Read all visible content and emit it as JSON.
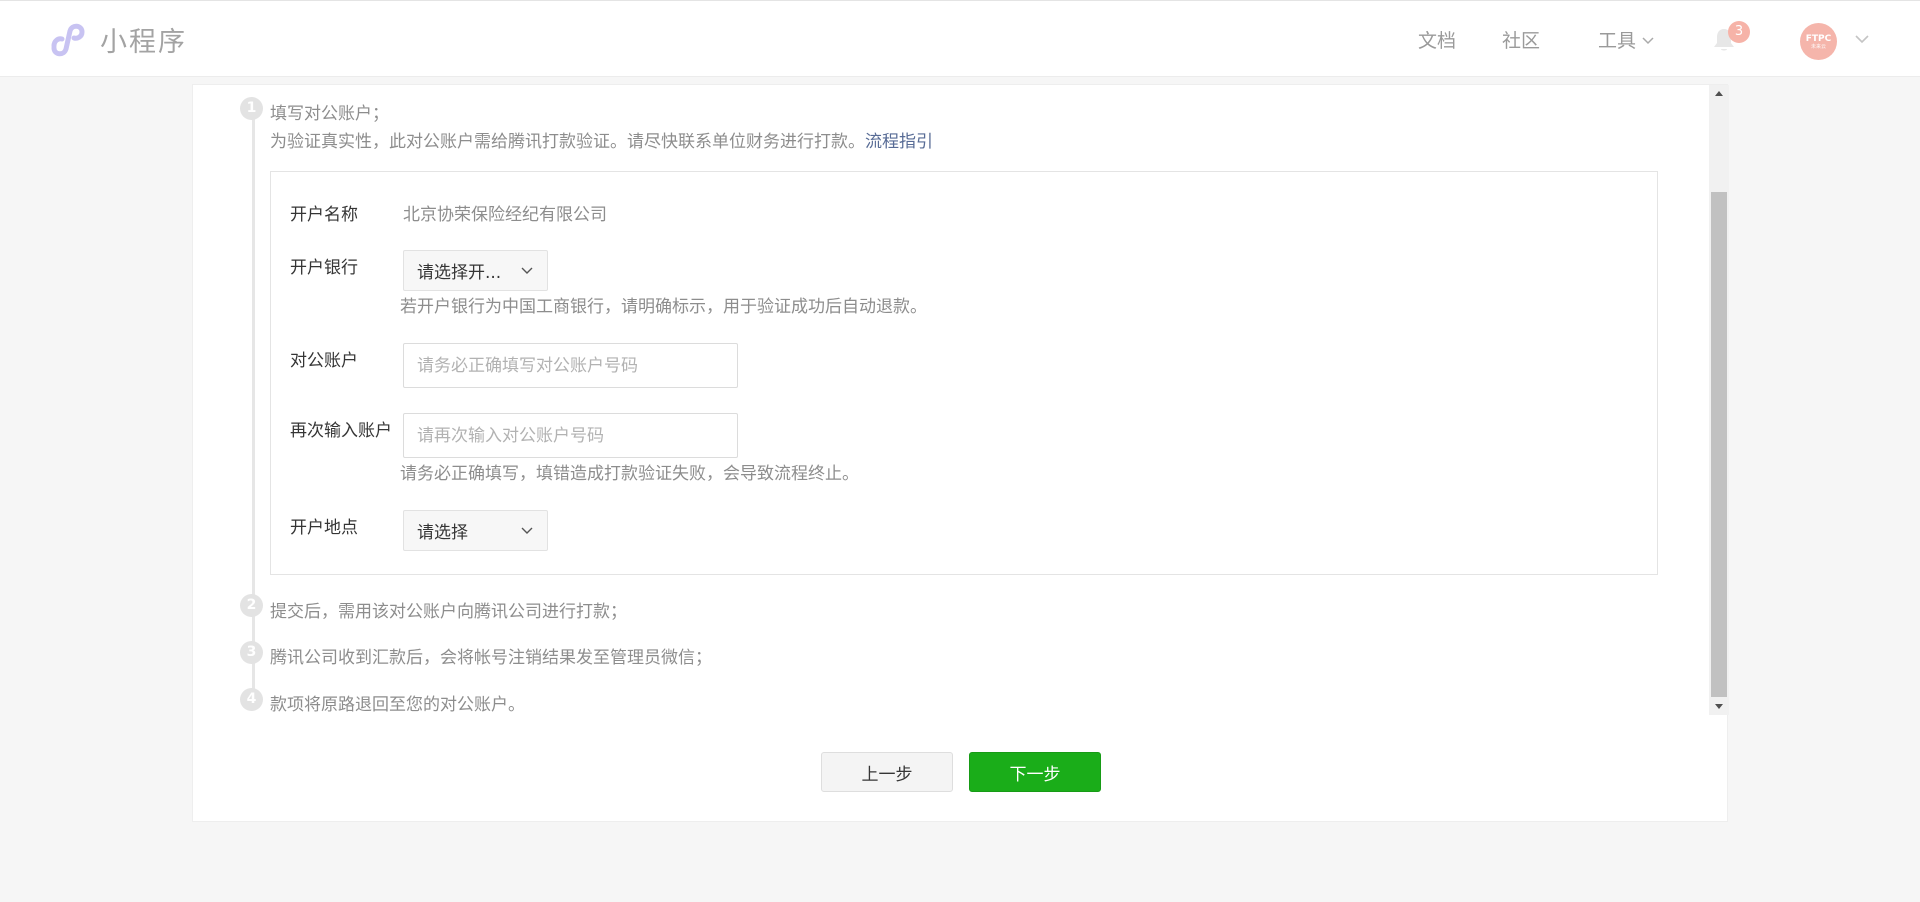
{
  "header": {
    "app_name": "小程序",
    "nav": {
      "docs": "文档",
      "community": "社区",
      "tools": "工具"
    },
    "notification_count": "3",
    "avatar": {
      "main": "FTPC",
      "sub": "未来云"
    }
  },
  "steps": [
    {
      "number": "1",
      "title": "填写对公账户；",
      "description": "为验证真实性，此对公账户需给腾讯打款验证。请尽快联系单位财务进行打款。",
      "link": "流程指引"
    },
    {
      "number": "2",
      "title": "提交后，需用该对公账户向腾讯公司进行打款；"
    },
    {
      "number": "3",
      "title": "腾讯公司收到汇款后，会将帐号注销结果发至管理员微信；"
    },
    {
      "number": "4",
      "title": "款项将原路退回至您的对公账户。"
    }
  ],
  "form": {
    "account_name": {
      "label": "开户名称",
      "value": "北京协荣保险经纪有限公司"
    },
    "bank": {
      "label": "开户银行",
      "selected": "请选择开...",
      "tip": "若开户银行为中国工商银行，请明确标示，用于验证成功后自动退款。"
    },
    "account": {
      "label": "对公账户",
      "value": "",
      "placeholder": "请务必正确填写对公账户号码"
    },
    "account_confirm": {
      "label": "再次输入账户",
      "value": "",
      "placeholder": "请再次输入对公账户号码",
      "tip": "请务必正确填写，填错造成打款验证失败，会导致流程终止。"
    },
    "location": {
      "label": "开户地点",
      "selected": "请选择"
    }
  },
  "buttons": {
    "prev": "上一步",
    "next": "下一步"
  },
  "colors": {
    "primary_green": "#1aad19",
    "link_blue": "#576b95",
    "badge": "#f6b3a8",
    "logo_purple": "#c8c3f2"
  },
  "icons": [
    "logo-icon",
    "chevron-down-icon",
    "bell-icon",
    "scroll-up-arrow-icon",
    "scroll-down-arrow-icon"
  ]
}
